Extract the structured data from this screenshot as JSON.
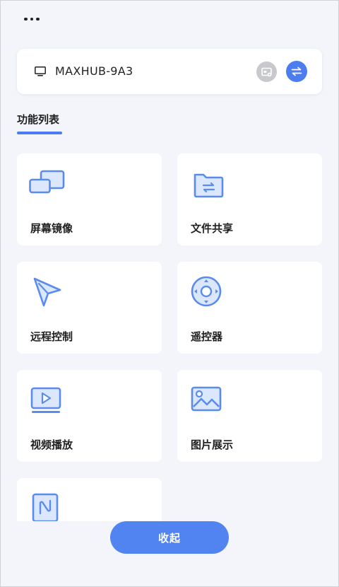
{
  "header": {
    "more_icon": "more-horizontal-icon"
  },
  "device": {
    "name": "MAXHUB-9A3",
    "icon": "monitor-icon",
    "cast_icon": "screen-cast-icon",
    "switch_icon": "switch-arrows-icon"
  },
  "section": {
    "title": "功能列表"
  },
  "features": [
    {
      "label": "屏幕镜像",
      "icon": "screen-mirror-icon"
    },
    {
      "label": "文件共享",
      "icon": "file-share-folder-icon"
    },
    {
      "label": "远程控制",
      "icon": "remote-control-cursor-icon"
    },
    {
      "label": "遥控器",
      "icon": "remote-dpad-icon"
    },
    {
      "label": "视频播放",
      "icon": "video-play-icon"
    },
    {
      "label": "图片展示",
      "icon": "image-gallery-icon"
    },
    {
      "label": "",
      "icon": "nfc-icon"
    }
  ],
  "footer": {
    "collapse_label": "收起"
  },
  "colors": {
    "accent": "#4b7cf0",
    "icon_stroke": "#5b8ced",
    "icon_fill": "#dbe7fd",
    "background": "#f3f5fa"
  }
}
